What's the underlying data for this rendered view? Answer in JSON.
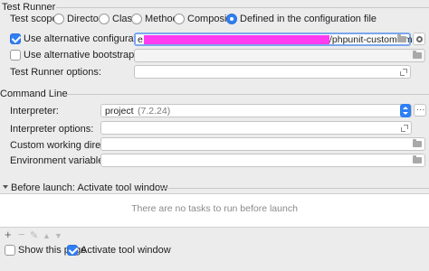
{
  "test_runner": {
    "title": "Test Runner",
    "scope_label": "Test scope:",
    "scope_options": [
      "Directory",
      "Class",
      "Method",
      "Composite",
      "Defined in the configuration file"
    ],
    "selected_scope": "Defined in the configuration file",
    "alt_config_label": "Use alternative configuration file:",
    "alt_config_checked": true,
    "alt_config_value_prefix": "e",
    "alt_config_value_suffix": "/phpunit-custom.xml",
    "alt_bootstrap_label": "Use alternative bootstrap file:",
    "alt_bootstrap_checked": false,
    "alt_bootstrap_value": "",
    "runner_options_label": "Test Runner options:",
    "runner_options_value": ""
  },
  "command_line": {
    "title": "Command Line",
    "interpreter_label": "Interpreter:",
    "interpreter_name": "project",
    "interpreter_version": "(7.2.24)",
    "interpreter_more": "...",
    "interpreter_options_label": "Interpreter options:",
    "interpreter_options_value": "",
    "working_dir_label": "Custom working directory:",
    "working_dir_value": "",
    "env_vars_label": "Environment variables:",
    "env_vars_value": ""
  },
  "before_launch": {
    "title": "Before launch: Activate tool window",
    "empty_text": "There are no tasks to run before launch",
    "toolbar": [
      "+",
      "−",
      "✎",
      "▲",
      "▼"
    ]
  },
  "footer": {
    "show_page_label": "Show this page",
    "show_page_checked": false,
    "activate_tool_label": "Activate tool window",
    "activate_tool_checked": true
  },
  "colors": {
    "accent": "#2f7ff5",
    "redaction": "#ff3bf0",
    "background": "#ececec"
  }
}
